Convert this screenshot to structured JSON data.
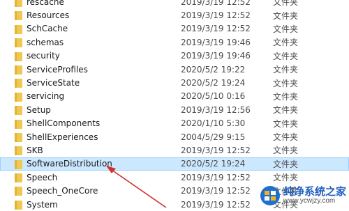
{
  "folder_type": "文件夹",
  "folder_icon": "folder-icon",
  "colors": {
    "folder": "#f0c850",
    "selected_bg": "#cce8ff",
    "selected_border": "#99d1ff",
    "arrow": "#d0312d"
  },
  "rows": [
    {
      "name": "rescache",
      "date": "2019/3/19 12:52"
    },
    {
      "name": "Resources",
      "date": "2019/3/19 12:52"
    },
    {
      "name": "SchCache",
      "date": "2019/3/19 12:52"
    },
    {
      "name": "schemas",
      "date": "2019/3/19 19:46"
    },
    {
      "name": "security",
      "date": "2019/3/19 19:46"
    },
    {
      "name": "ServiceProfiles",
      "date": "2020/5/2 19:22"
    },
    {
      "name": "ServiceState",
      "date": "2020/5/2 19:24"
    },
    {
      "name": "servicing",
      "date": "2020/5/10 0:16"
    },
    {
      "name": "Setup",
      "date": "2019/3/19 12:56"
    },
    {
      "name": "ShellComponents",
      "date": "2020/1/10 5:30"
    },
    {
      "name": "ShellExperiences",
      "date": "2004/5/29 9:15"
    },
    {
      "name": "SKB",
      "date": "2019/3/19 12:52"
    },
    {
      "name": "SoftwareDistribution",
      "date": "2020/5/2 19:24",
      "selected": true
    },
    {
      "name": "Speech",
      "date": "2019/3/19 12:52"
    },
    {
      "name": "Speech_OneCore",
      "date": "2019/3/19 12:52"
    },
    {
      "name": "System",
      "date": "2019/3/19 12:52"
    }
  ],
  "watermark": {
    "title": "纯净系统之家",
    "url": "www.ycwjzy.com"
  }
}
